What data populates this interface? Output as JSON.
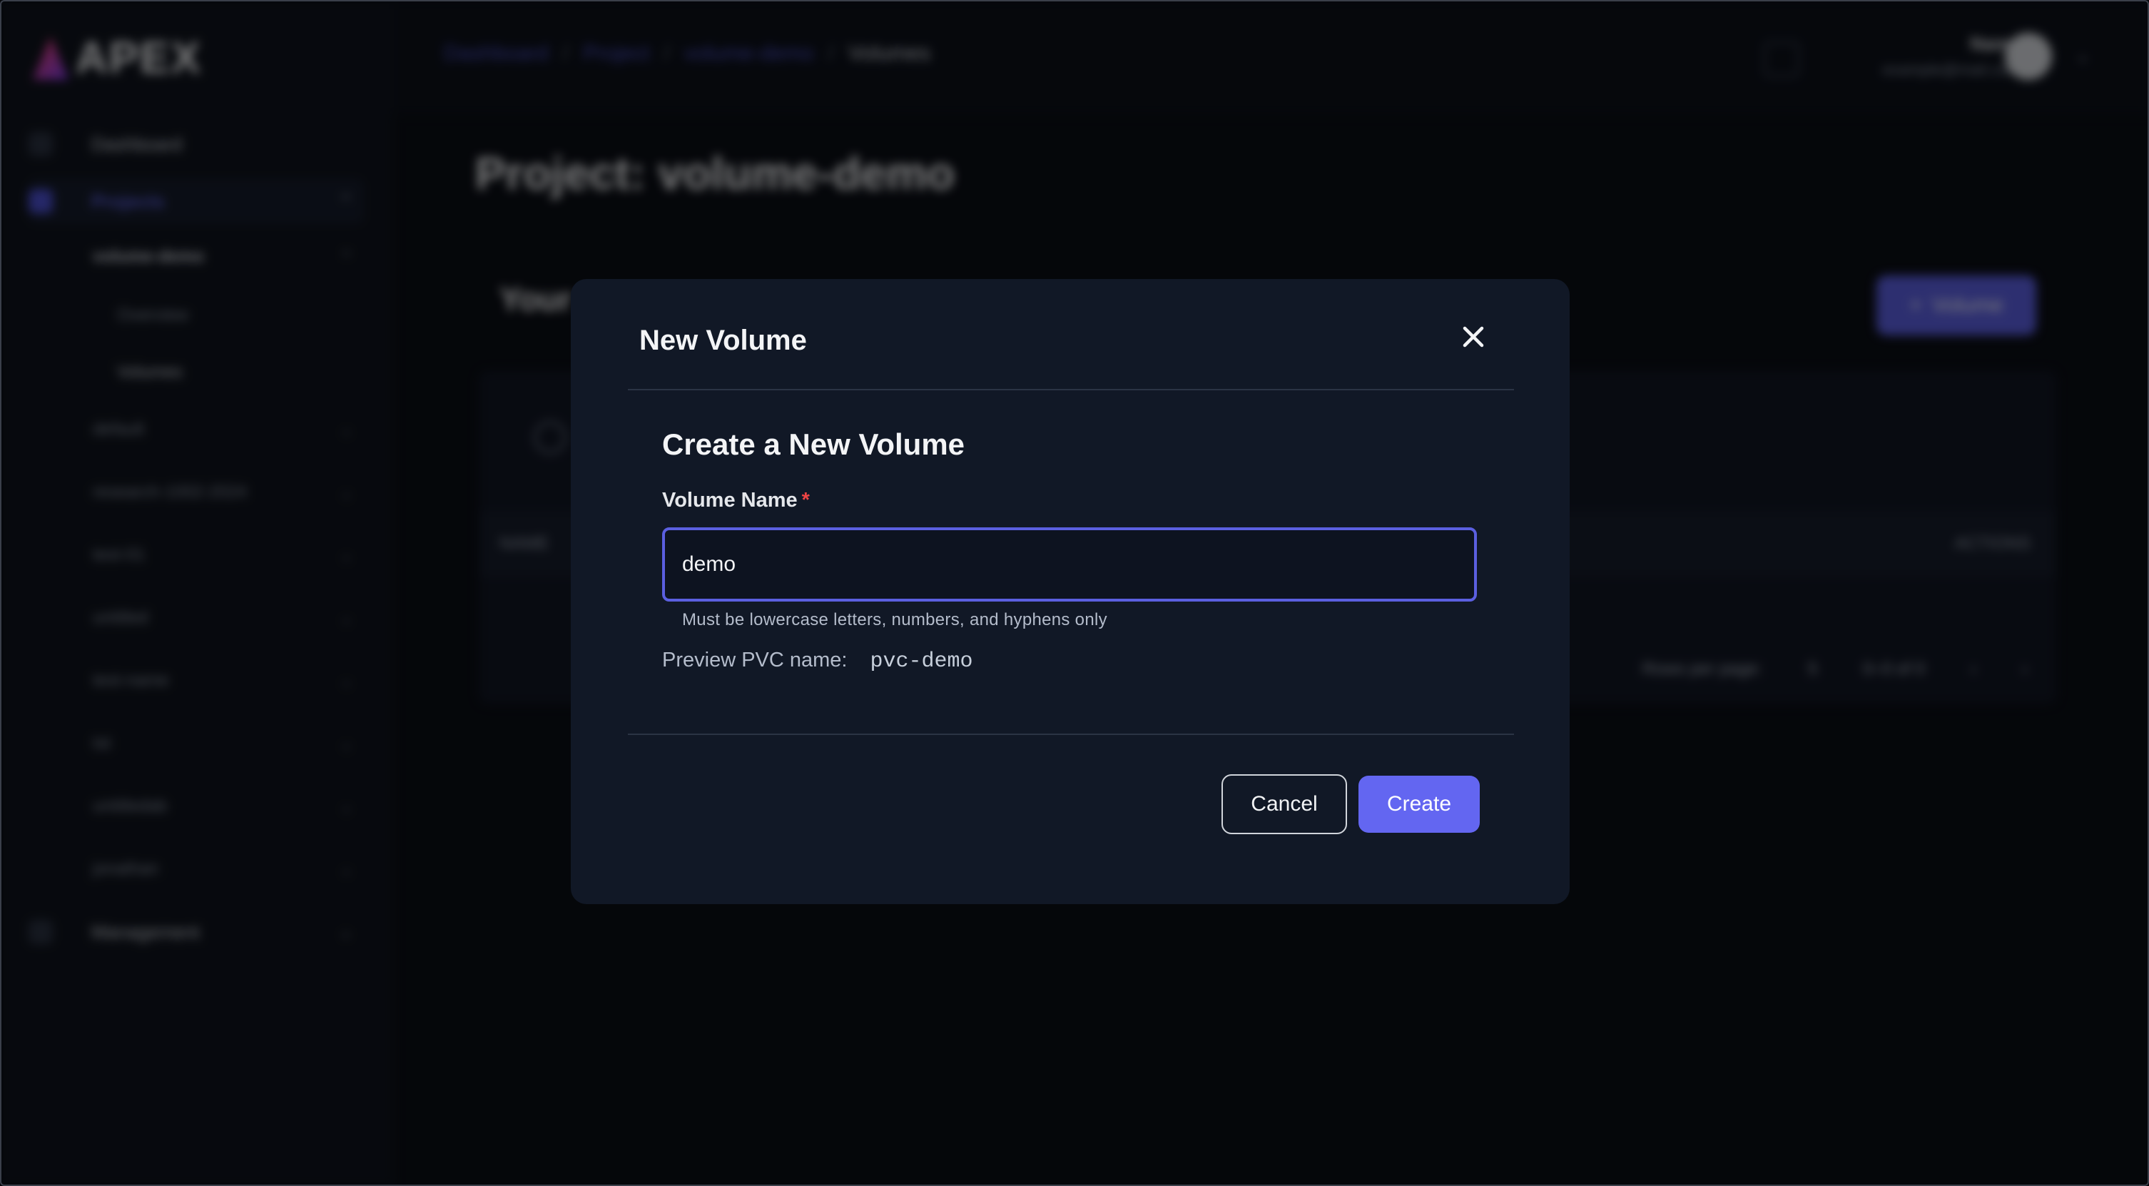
{
  "app": {
    "logo_text": "APEX"
  },
  "sidebar": {
    "items": [
      {
        "label": "Dashboard"
      },
      {
        "label": "Projects"
      },
      {
        "label": "Management"
      }
    ],
    "projects": [
      {
        "label": "volume-demo"
      },
      {
        "label": "default"
      },
      {
        "label": "research-1002-2024"
      },
      {
        "label": "test-01"
      },
      {
        "label": "untitled"
      },
      {
        "label": "test-name"
      },
      {
        "label": "tst"
      },
      {
        "label": "untitledab"
      },
      {
        "label": "jonathan"
      }
    ],
    "sub_items": [
      {
        "label": "Overview"
      },
      {
        "label": "Volumes"
      }
    ]
  },
  "header": {
    "breadcrumbs": [
      "Dashboard",
      "Project",
      "volume-demo",
      "Volumes"
    ],
    "user_name": "Name",
    "user_email": "example@mail.com"
  },
  "main": {
    "page_title": "Project: volume-demo",
    "section_title": "Your",
    "add_button_label": "Volume",
    "table": {
      "columns": [
        "NAME",
        "ACTIONS"
      ]
    },
    "pagination": {
      "rows_label": "Rows per page:",
      "rows_value": "5",
      "range": "0–0 of 0"
    }
  },
  "modal": {
    "title": "New Volume",
    "heading": "Create a New Volume",
    "field_label": "Volume Name",
    "required_mark": "*",
    "input_value": "demo",
    "hint": "Must be lowercase letters, numbers, and hyphens only",
    "preview_label": "Preview PVC name:",
    "preview_value": "pvc-demo",
    "cancel_label": "Cancel",
    "create_label": "Create",
    "accent_color": "#6366f1"
  }
}
